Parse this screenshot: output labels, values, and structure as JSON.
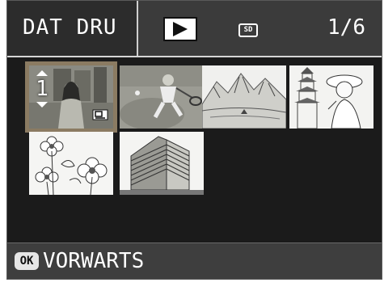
{
  "header": {
    "title": "DAT DRU",
    "mode_icon": "play-icon",
    "media_icon": "sd-card-icon",
    "media_label": "SD",
    "page_counter": "1/6"
  },
  "thumbnails": [
    {
      "subject": "woman-portrait",
      "selected": true,
      "print_copies": "1",
      "has_print_mark": true
    },
    {
      "subject": "tennis-player",
      "selected": false
    },
    {
      "subject": "mountain-landscape",
      "selected": false
    },
    {
      "subject": "woman-with-pagoda",
      "selected": false
    },
    {
      "subject": "flowers",
      "selected": false
    },
    {
      "subject": "apartment-building",
      "selected": false
    }
  ],
  "footer": {
    "ok_label": "OK",
    "action_label": "VORWARTS"
  },
  "colors": {
    "background": "#1b1b1b",
    "header_bar": "#3b3b3b",
    "selection_frame": "#8b7b62",
    "text": "#ffffff"
  }
}
